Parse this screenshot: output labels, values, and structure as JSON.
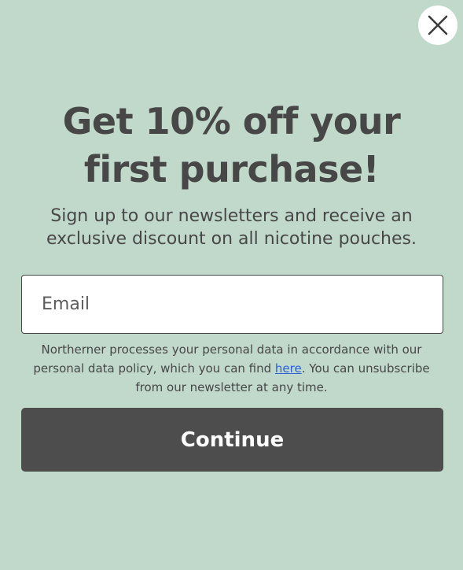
{
  "popup": {
    "headline_line1": "Get 10% off your",
    "headline_line2": "first purchase!",
    "subhead": "Sign up to our newsletters and receive an exclusive discount on all nicotine pouches.",
    "email_placeholder": "Email",
    "email_value": "",
    "disclaimer_before": "Northerner processes your personal data in accordance with our personal data policy, which you can find ",
    "disclaimer_link": "here",
    "disclaimer_after": ". You can unsubscribe from our newsletter at any time.",
    "continue_label": "Continue",
    "close_icon": "close-icon"
  },
  "colors": {
    "background": "#c0d9cb",
    "text": "#474747",
    "button": "#4d4d4d",
    "link": "#2b5fd9"
  }
}
